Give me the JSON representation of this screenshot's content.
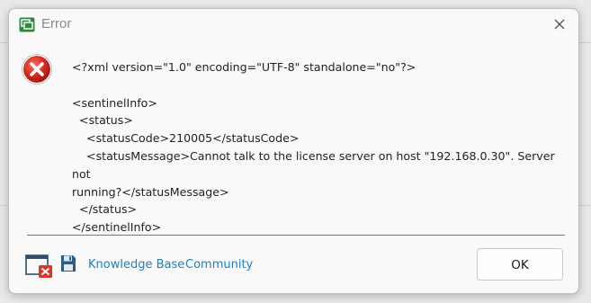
{
  "window": {
    "title": "Error",
    "close_icon": "close-icon",
    "app_icon": "app-window-icon"
  },
  "body": {
    "status_icon": "error-icon",
    "status_color": "#c8201f",
    "message": "<?xml version=\"1.0\" encoding=\"UTF-8\" standalone=\"no\"?>\n\n<sentinelInfo>\n  <status>\n    <statusCode>210005</statusCode>\n    <statusMessage>Cannot talk to the license server on host \"192.168.0.30\". Server not\nrunning?</statusMessage>\n  </status>\n</sentinelInfo>"
  },
  "footer": {
    "close_window_icon": "close-window-icon",
    "save_icon": "save-icon",
    "links": {
      "knowledge_base": "Knowledge Base",
      "community": "Community"
    },
    "link_color": "#1f7fc1",
    "ok_label": "OK"
  }
}
